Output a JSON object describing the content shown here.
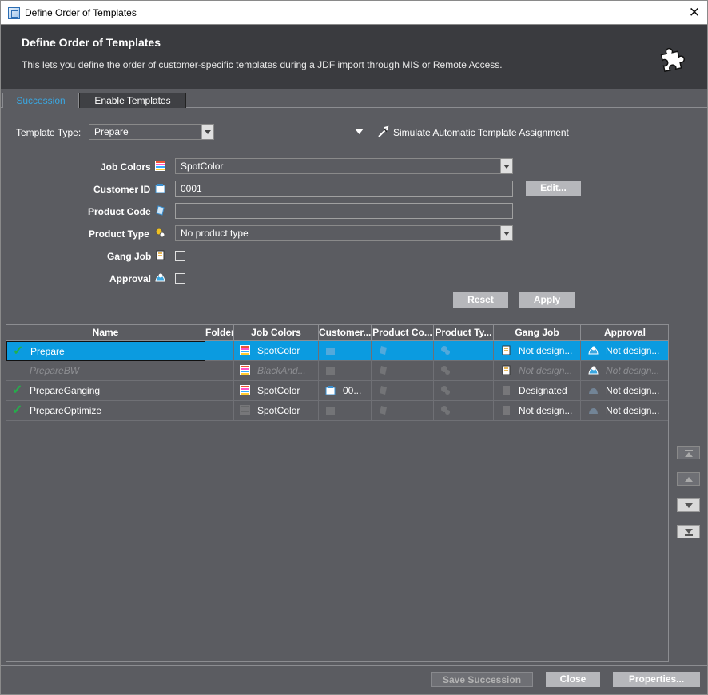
{
  "window": {
    "title": "Define Order of Templates",
    "close_glyph": "✕"
  },
  "header": {
    "title": "Define Order of Templates",
    "description": "This lets you define the order of customer-specific templates during a JDF import through MIS or Remote Access.",
    "icon": "puzzle-icon"
  },
  "tabs": [
    {
      "label": "Succession",
      "active": true
    },
    {
      "label": "Enable Templates",
      "active": false
    }
  ],
  "filter": {
    "template_type_label": "Template Type:",
    "template_type_value": "Prepare",
    "simulate_label": "Simulate Automatic Template Assignment"
  },
  "form": {
    "job_colors": {
      "label": "Job Colors",
      "value": "SpotColor"
    },
    "customer_id": {
      "label": "Customer ID",
      "value": "0001",
      "edit_label": "Edit..."
    },
    "product_code": {
      "label": "Product Code",
      "value": ""
    },
    "product_type": {
      "label": "Product Type",
      "value": "No product type"
    },
    "gang_job": {
      "label": "Gang Job",
      "checked": false
    },
    "approval": {
      "label": "Approval",
      "checked": false
    },
    "reset_label": "Reset",
    "apply_label": "Apply"
  },
  "table": {
    "columns": [
      "Name",
      "Folder",
      "Job Colors",
      "Customer...",
      "Product Co...",
      "Product Ty...",
      "Gang Job",
      "Approval"
    ],
    "rows": [
      {
        "name": "Prepare",
        "checked": true,
        "selected": true,
        "dim": false,
        "folder": "",
        "job_colors": "SpotColor",
        "customer": "",
        "product_code": "",
        "product_type": "",
        "gang_job": "Not design...",
        "approval": "Not design..."
      },
      {
        "name": "PrepareBW",
        "checked": false,
        "selected": false,
        "dim": true,
        "folder": "",
        "job_colors": "BlackAnd...",
        "customer": "",
        "product_code": "",
        "product_type": "",
        "gang_job": "Not design...",
        "approval": "Not design..."
      },
      {
        "name": "PrepareGanging",
        "checked": true,
        "selected": false,
        "dim": false,
        "folder": "",
        "job_colors": "SpotColor",
        "customer": "00...",
        "product_code": "",
        "product_type": "",
        "gang_job": "Designated",
        "approval": "Not design..."
      },
      {
        "name": "PrepareOptimize",
        "checked": true,
        "selected": false,
        "dim": false,
        "folder": "",
        "job_colors": "SpotColor",
        "customer": "",
        "product_code": "",
        "product_type": "",
        "gang_job": "Not design...",
        "approval": "Not design..."
      }
    ]
  },
  "footer": {
    "save_label": "Save Succession",
    "close_label": "Close",
    "properties_label": "Properties..."
  },
  "colors": {
    "accent": "#0b9be0",
    "tab_active_text": "#3aa6e0",
    "check": "#23b04a",
    "background": "#5b5c61",
    "header_bg": "#3a3b3f"
  }
}
